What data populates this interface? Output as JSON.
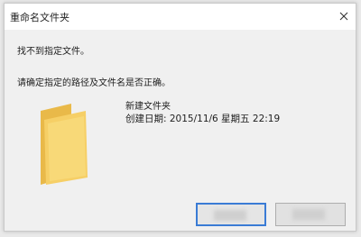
{
  "dialog": {
    "title": "重命名文件夹",
    "close_icon": "close-icon"
  },
  "message": {
    "line1": "找不到指定文件。",
    "line2": "请确定指定的路径及文件名是否正确。"
  },
  "file": {
    "icon": "folder-icon",
    "name": "新建文件夹",
    "created": "创建日期: 2015/11/6 星期五 22:19"
  },
  "colors": {
    "folder_body": "#f2c75c",
    "folder_front": "#f8d978",
    "primary_border": "#3a7bd5"
  }
}
